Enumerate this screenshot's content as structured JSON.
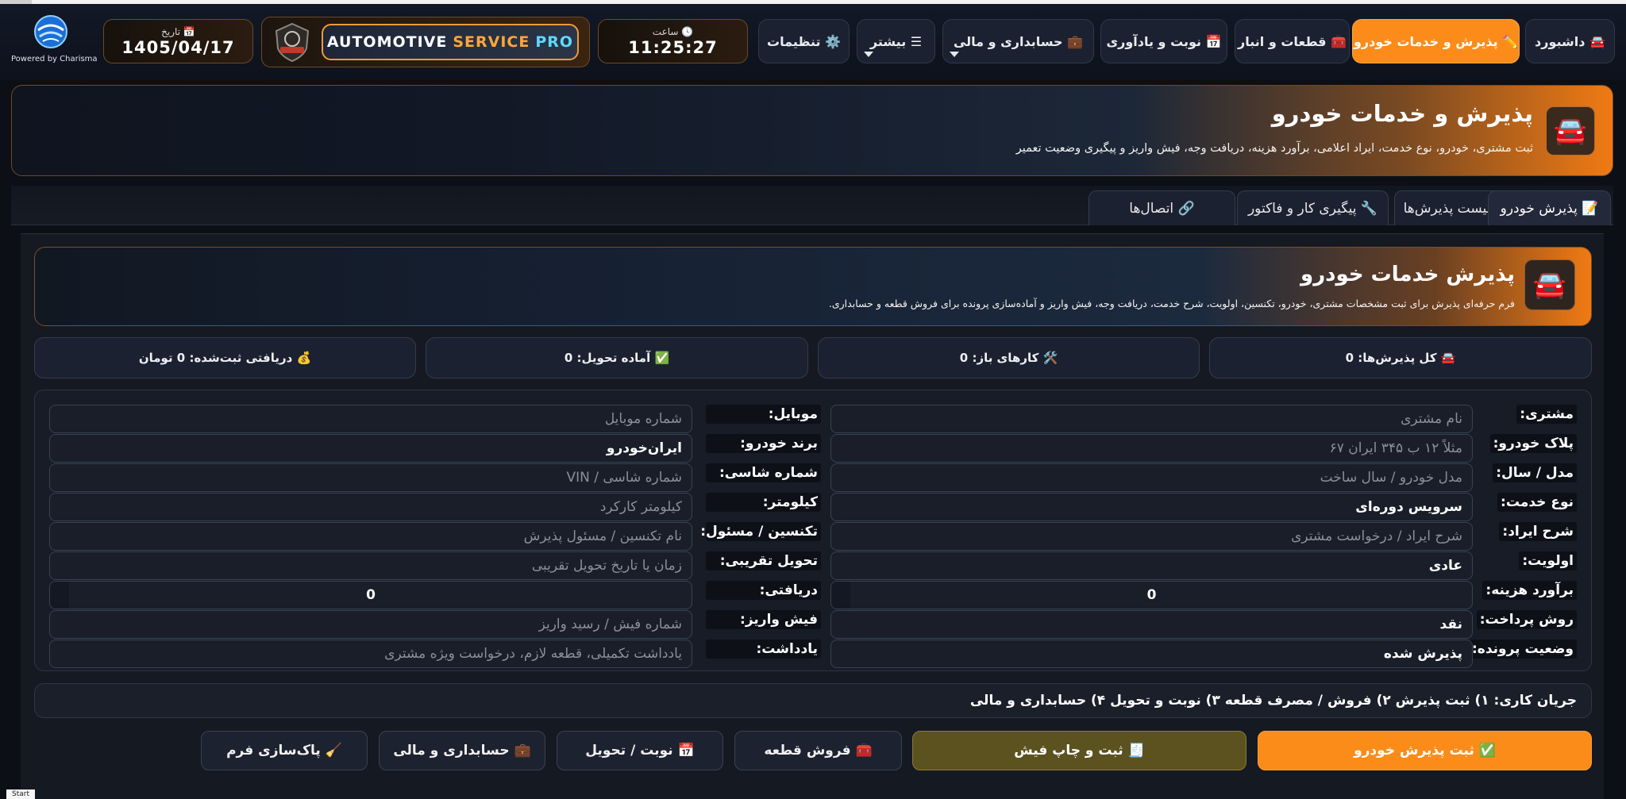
{
  "logo": {
    "powered_by": "Powered by Charisma"
  },
  "date": {
    "label": "📅 تاریخ",
    "value": "1405/04/17"
  },
  "brand": {
    "part1": "AUTOMOTIVE",
    "part2": "SERVICE",
    "part3": "PRO"
  },
  "clock": {
    "label": "🕓 ساعت",
    "value": "11:25:27"
  },
  "nav": {
    "dashboard": "🚘 داشبورد",
    "reception": "✏️ پذیرش و خدمات خودرو",
    "parts": "🧰 قطعات و انبار",
    "appointments": "📅 نوبت و یادآوری",
    "accounting": "💼 حسابداری و مالی",
    "more": "☰ بیشتر",
    "settings": "⚙️ تنظیمات"
  },
  "colors": {
    "accent": "#fb8c1a",
    "background": "#0c0f15",
    "panel": "#171c26"
  },
  "hero": {
    "icon": "car-icon",
    "title": "پذیرش و خدمات خودرو",
    "subtitle": "ثبت مشتری، خودرو، نوع خدمت، ایراد اعلامی، برآورد هزینه، دریافت وجه، فیش واریز و پیگیری وضعیت تعمیر"
  },
  "tabs": [
    {
      "label": "📝 پذیرش خودرو"
    },
    {
      "label": "📋 لیست پذیرش‌ها"
    },
    {
      "label": "🔧 پیگیری کار و فاکتور"
    },
    {
      "label": "🔗 اتصال‌ها"
    }
  ],
  "subhero": {
    "icon": "car-icon",
    "title": "پذیرش خدمات خودرو",
    "subtitle": "فرم حرفه‌ای پذیرش برای ثبت مشخصات مشتری، خودرو، تکنسین، اولویت، شرح خدمت، دریافت وجه، فیش واریز و آماده‌سازی پرونده برای فروش قطعه و حسابداری."
  },
  "stats": {
    "total": "🚘 کل پذیرش‌ها: 0",
    "open": "🛠️ کارهای باز: 0",
    "ready": "✅ آماده تحویل: 0",
    "received": "💰 دریافتی ثبت‌شده: 0 تومان"
  },
  "form": {
    "right": [
      {
        "label": "مشتری:",
        "value": "",
        "placeholder": "نام مشتری"
      },
      {
        "label": "پلاک خودرو:",
        "value": "",
        "placeholder": "مثلاً ۱۲ ب ۳۴۵ ایران ۶۷"
      },
      {
        "label": "مدل / سال:",
        "value": "",
        "placeholder": "مدل خودرو / سال ساخت"
      },
      {
        "label": "نوع خدمت:",
        "value": "سرویس دوره‌ای",
        "placeholder": ""
      },
      {
        "label": "شرح ایراد:",
        "value": "",
        "placeholder": "شرح ایراد / درخواست مشتری"
      },
      {
        "label": "اولویت:",
        "value": "عادی",
        "placeholder": ""
      },
      {
        "label": "برآورد هزینه:",
        "value": "0",
        "placeholder": ""
      },
      {
        "label": "روش پرداخت:",
        "value": "نقد",
        "placeholder": ""
      },
      {
        "label": "وضعیت پرونده:",
        "value": "پذیرش شده",
        "placeholder": ""
      }
    ],
    "left": [
      {
        "label": "موبایل:",
        "value": "",
        "placeholder": "شماره موبایل"
      },
      {
        "label": "برند خودرو:",
        "value": "ایران‌خودرو",
        "placeholder": ""
      },
      {
        "label": "شماره شاسی:",
        "value": "",
        "placeholder": "شماره شاسی / VIN"
      },
      {
        "label": "کیلومتر:",
        "value": "",
        "placeholder": "کیلومتر کارکرد"
      },
      {
        "label": "تکنسین / مسئول:",
        "value": "",
        "placeholder": "نام تکنسین / مسئول پذیرش"
      },
      {
        "label": "تحویل تقریبی:",
        "value": "",
        "placeholder": "زمان یا تاریخ تحویل تقریبی"
      },
      {
        "label": "دریافتی:",
        "value": "0",
        "placeholder": ""
      },
      {
        "label": "فیش واریز:",
        "value": "",
        "placeholder": "شماره فیش / رسید واریز"
      },
      {
        "label": "یادداشت:",
        "value": "",
        "placeholder": "یادداشت تکمیلی، قطعه لازم، درخواست ویژه مشتری"
      }
    ]
  },
  "workflow": "جریان کاری: ۱) ثبت پذیرش  ۲) فروش / مصرف قطعه  ۳) نوبت و تحویل  ۴) حسابداری و مالی",
  "actions": {
    "submit": "✅ ثبت پذیرش خودرو",
    "print": "🧾 ثبت و چاپ فیش",
    "sell_parts": "🧰 فروش قطعه",
    "appointment": "📅 نوبت / تحویل",
    "accounting": "💼 حسابداری و مالی",
    "clear": "🧹 پاک‌سازی فرم"
  },
  "taskbar": {
    "start": "Start"
  }
}
